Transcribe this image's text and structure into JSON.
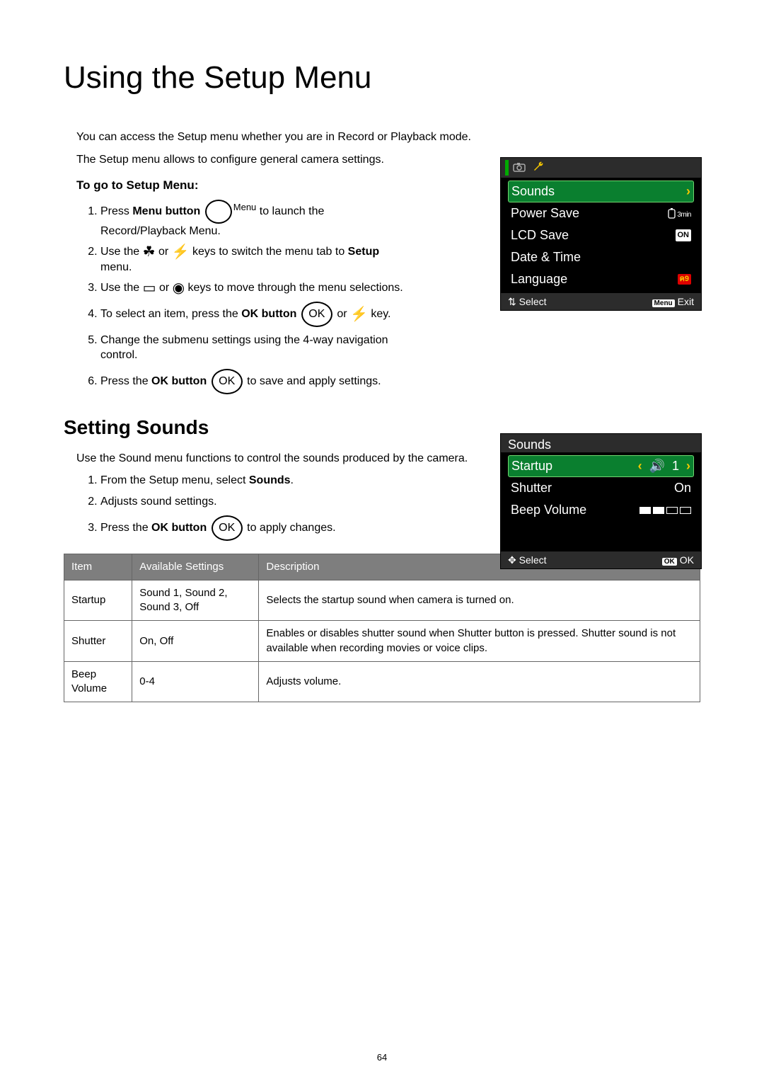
{
  "title": "Using the Setup Menu",
  "intro1": "You can access the Setup menu whether you are in Record or Playback mode.",
  "intro2": "The Setup menu allows to configure general camera settings.",
  "toGoHeader": "To go to Setup Menu:",
  "steps": {
    "s1a": "Press ",
    "s1b": "Menu button",
    "s1c": " to launch the Record/Playback Menu.",
    "s2a": "Use the ",
    "s2b": " or ",
    "s2c": " keys to switch the menu tab to ",
    "s2d": "Setup",
    "s2e": " menu.",
    "s3a": "Use the ",
    "s3b": " or ",
    "s3c": " keys to move through the menu selections.",
    "s4a": "To select an item, press the ",
    "s4b": "OK button",
    "s4c": " or ",
    "s4d": " key.",
    "s5": "Change the submenu settings using the 4-way navigation control.",
    "s6a": "Press the ",
    "s6b": "OK button",
    "s6c": " to save and apply settings."
  },
  "menuLabel": "Menu",
  "okLabel": "OK",
  "screen1": {
    "items": [
      "Sounds",
      "Power Save",
      "LCD Save",
      "Date & Time",
      "Language"
    ],
    "lcdBadge": "ON",
    "powerBadge": "3min",
    "footerLeft": "Select",
    "footerRight": "Exit",
    "footerMenu": "Menu"
  },
  "soundsHeader": "Setting Sounds",
  "soundsIntro": "Use the Sound menu functions to control the sounds produced by the camera.",
  "soundsSteps": {
    "s1a": "From the Setup menu, select ",
    "s1b": "Sounds",
    "s1c": ".",
    "s2": "Adjusts sound settings.",
    "s3a": "Press the ",
    "s3b": "OK button",
    "s3c": " to apply changes."
  },
  "screen2": {
    "title": "Sounds",
    "rows": [
      {
        "label": "Startup",
        "value": "1"
      },
      {
        "label": "Shutter",
        "value": "On"
      },
      {
        "label": "Beep Volume",
        "value": ""
      }
    ],
    "footerLeft": "Select",
    "footerRight": "OK",
    "footerBadge": "OK"
  },
  "table": {
    "headers": [
      "Item",
      "Available Settings",
      "Description"
    ],
    "rows": [
      {
        "item": "Startup",
        "settings": "Sound 1, Sound 2, Sound 3, Off",
        "desc": "Selects the startup sound when camera is turned on."
      },
      {
        "item": "Shutter",
        "settings": "On, Off",
        "desc": "Enables or disables shutter sound when Shutter button is pressed. Shutter sound is not available when recording movies or voice clips."
      },
      {
        "item": "Beep Volume",
        "settings": "0-4",
        "desc": "Adjusts volume."
      }
    ]
  },
  "pageNum": "64"
}
